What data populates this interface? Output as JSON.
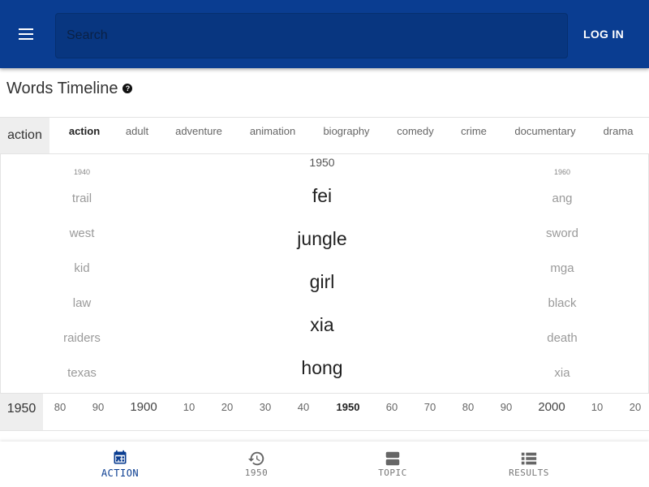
{
  "header": {
    "search_placeholder": "Search",
    "login_label": "LOG IN"
  },
  "page": {
    "title": "Words Timeline"
  },
  "genres": {
    "current": "action",
    "tabs": [
      "action",
      "adult",
      "adventure",
      "animation",
      "biography",
      "comedy",
      "crime",
      "documentary",
      "drama"
    ],
    "active": "action"
  },
  "timeline": {
    "left": {
      "year": "1940",
      "words": [
        "trail",
        "west",
        "kid",
        "law",
        "raiders",
        "texas"
      ]
    },
    "center": {
      "year": "1950",
      "words": [
        "fei",
        "jungle",
        "girl",
        "xia",
        "hong"
      ]
    },
    "right": {
      "year": "1960",
      "words": [
        "ang",
        "sword",
        "mga",
        "black",
        "death",
        "xia"
      ]
    }
  },
  "years": {
    "current": "1950",
    "ticks": [
      "80",
      "90",
      "1900",
      "10",
      "20",
      "30",
      "40",
      "1950",
      "60",
      "70",
      "80",
      "90",
      "2000",
      "10",
      "20"
    ],
    "active": "1950"
  },
  "bottom_nav": {
    "items": [
      {
        "label": "ACTION",
        "icon": "calendar-icon",
        "active": true
      },
      {
        "label": "1950",
        "icon": "history-icon",
        "active": false
      },
      {
        "label": "TOPIC",
        "icon": "view-agenda-icon",
        "active": false
      },
      {
        "label": "RESULTS",
        "icon": "list-icon",
        "active": false
      }
    ]
  },
  "colors": {
    "appbar": "#0a3d91",
    "active_nav": "#0a3d91",
    "muted_word": "#9a9a9a"
  }
}
